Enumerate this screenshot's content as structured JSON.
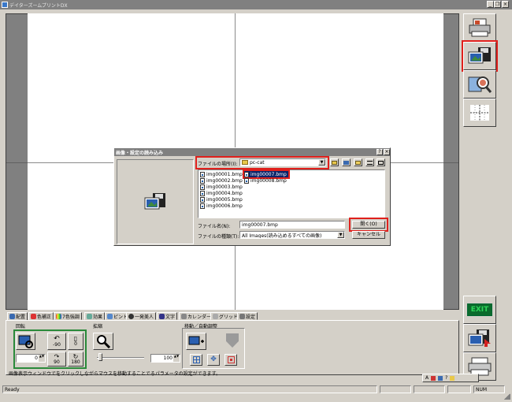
{
  "window": {
    "title": "デイターズームプリントDX"
  },
  "dialog": {
    "title": "画像・設定の読み込み",
    "lookin_label": "ファイルの場所(I):",
    "lookin_value": "pc-cat",
    "files_col1": [
      "img00001.bmp",
      "img00002.bmp",
      "img00003.bmp",
      "img00004.bmp",
      "img00005.bmp",
      "img00006.bmp"
    ],
    "files_col2": [
      "img00007.bmp",
      "img00008.bmp"
    ],
    "selected_file": "img00007.bmp",
    "filename_label": "ファイル名(N):",
    "filename_value": "img00007.bmp",
    "filetype_label": "ファイルの種類(T):",
    "filetype_value": "All Images(読み込めるすべての画像)",
    "open_label": "開く(O)",
    "cancel_label": "キャンセル"
  },
  "tabs": [
    "配置",
    "色補正",
    "7色強調",
    "効果",
    "ピント",
    "一発美人",
    "文字",
    "カレンダー",
    "グリッド",
    "設定"
  ],
  "panel": {
    "rotate_label": "回転",
    "zoom_label": "拡縮",
    "move_label": "移動／自動調整",
    "rot_minus90": "-90",
    "rot_zero": "0",
    "rot_plus90": "90",
    "rot_180": "180",
    "angle_value": "0",
    "zoom_value": "100",
    "hint": "画像表示ウィンドウでをクリックしながらマウスを移動することでるパラメータの設定ができます。"
  },
  "side": {
    "exit_label": "EXIT"
  },
  "status": {
    "ready": "Ready",
    "num": "NUM"
  },
  "colors": {
    "highlight": "#e0201c",
    "selection": "#0a246a",
    "exit_bg": "#0b6b2c",
    "exit_text": "#2ed65a"
  }
}
